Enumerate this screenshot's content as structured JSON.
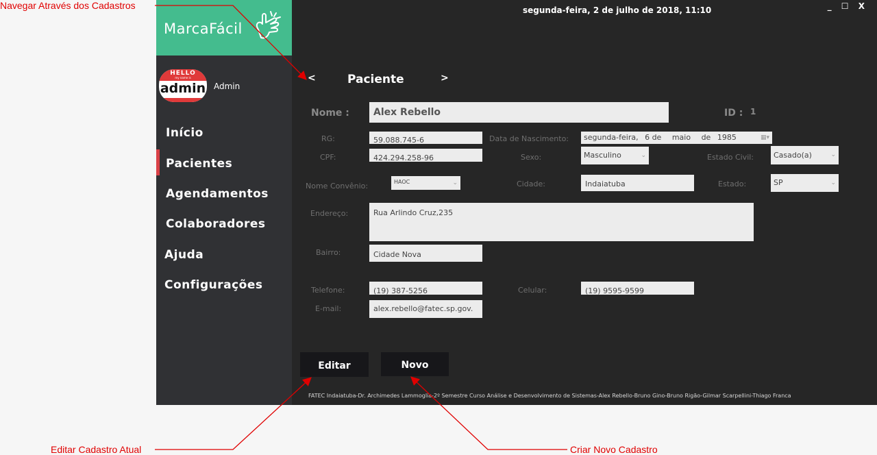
{
  "annotations": {
    "navigate": "Navegar Através dos Cadastros",
    "edit": "Editar Cadastro Atual",
    "new": "Criar Novo Cadastro"
  },
  "app": {
    "logo": "MarcaFácil",
    "datetime": "segunda-feira, 2 de julho de 2018, 11:10",
    "window_controls": {
      "minimize": "_",
      "maximize": "☐",
      "close": "X"
    },
    "avatar": {
      "hello": "HELLO",
      "sub": "my name is",
      "name": "admin"
    },
    "user_name": "Admin",
    "nav": [
      "Início",
      "Pacientes",
      "Agendamentos",
      "Colaboradores",
      "Ajuda",
      "Configurações"
    ],
    "active_nav": "Pacientes",
    "accent_color": "#44bc8e",
    "marker_color": "#d94046"
  },
  "form": {
    "prev": "<",
    "next": ">",
    "title": "Paciente",
    "nome_label": "Nome :",
    "nome": "Alex Rebello",
    "id_label": "ID :",
    "id": "1",
    "rg_label": "RG:",
    "rg": "59.088.745-6",
    "nascimento_label": "Data de Nascimento:",
    "nascimento": {
      "weekday": "segunda-feira,",
      "day": "6 de",
      "month": "maio",
      "de": "de",
      "year": "1985"
    },
    "cpf_label": "CPF:",
    "cpf": "424.294.258-96",
    "sexo_label": "Sexo:",
    "sexo": "Masculino",
    "estado_civil_label": "Estado Civil:",
    "estado_civil": "Casado(a)",
    "convenio_label": "Nome Convênio:",
    "convenio": "HAOC",
    "cidade_label": "Cidade:",
    "cidade": "Indaiatuba",
    "estado_label": "Estado:",
    "estado": "SP",
    "endereco_label": "Endereço:",
    "endereco": "Rua Arlindo Cruz,235",
    "bairro_label": "Bairro:",
    "bairro": "Cidade Nova",
    "telefone_label": "Telefone:",
    "telefone": "(19)  387-5256",
    "celular_label": "Celular:",
    "celular": "(19)  9595-9599",
    "email_label": "E-mail:",
    "email": "alex.rebello@fatec.sp.gov."
  },
  "buttons": {
    "edit": "Editar",
    "new": "Novo"
  },
  "footer": "FATEC Indaiatuba-Dr. Archimedes Lammoglia-2º Semestre Curso Análise e Desenvolvimento de Sistemas-Alex Rebello-Bruno Gino-Bruno Rigão-Gilmar Scarpellini-Thiago Franca"
}
